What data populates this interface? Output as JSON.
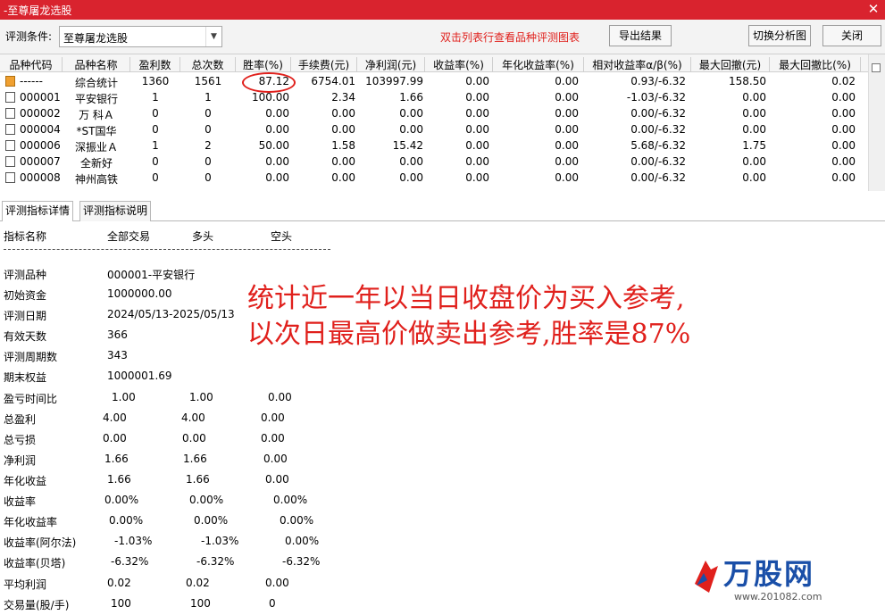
{
  "window": {
    "title": "-至尊屠龙选股"
  },
  "toolbar": {
    "condition_label": "评测条件:",
    "condition_value": "至尊屠龙选股",
    "hint": "双击列表行查看品种评测图表",
    "export_label": "导出结果",
    "switch_label": "切换分析图",
    "close_label": "关闭"
  },
  "grid": {
    "headers": [
      "品种代码",
      "品种名称",
      "盈利数",
      "总次数",
      "胜率(%)",
      "手续费(元)",
      "净利润(元)",
      "收益率(%)",
      "年化收益率(%)",
      "相对收益率α/β(%)",
      "最大回撤(元)",
      "最大回撤比(%)"
    ],
    "rows": [
      [
        "------",
        "综合统计",
        "1360",
        "1561",
        "87.12",
        "6754.01",
        "103997.99",
        "0.00",
        "0.00",
        "0.93/-6.32",
        "158.50",
        "0.02"
      ],
      [
        "000001",
        "平安银行",
        "1",
        "1",
        "100.00",
        "2.34",
        "1.66",
        "0.00",
        "0.00",
        "-1.03/-6.32",
        "0.00",
        "0.00"
      ],
      [
        "000002",
        "万 科Ａ",
        "0",
        "0",
        "0.00",
        "0.00",
        "0.00",
        "0.00",
        "0.00",
        "0.00/-6.32",
        "0.00",
        "0.00"
      ],
      [
        "000004",
        "*ST国华",
        "0",
        "0",
        "0.00",
        "0.00",
        "0.00",
        "0.00",
        "0.00",
        "0.00/-6.32",
        "0.00",
        "0.00"
      ],
      [
        "000006",
        "深振业Ａ",
        "1",
        "2",
        "50.00",
        "1.58",
        "15.42",
        "0.00",
        "0.00",
        "5.68/-6.32",
        "1.75",
        "0.00"
      ],
      [
        "000007",
        "全新好",
        "0",
        "0",
        "0.00",
        "0.00",
        "0.00",
        "0.00",
        "0.00",
        "0.00/-6.32",
        "0.00",
        "0.00"
      ],
      [
        "000008",
        "神州高铁",
        "0",
        "0",
        "0.00",
        "0.00",
        "0.00",
        "0.00",
        "0.00",
        "0.00/-6.32",
        "0.00",
        "0.00"
      ]
    ]
  },
  "tabs": [
    "评测指标详情",
    "评测指标说明"
  ],
  "detail": {
    "columns": [
      "指标名称",
      "全部交易",
      "多头",
      "空头"
    ],
    "single_rows": [
      [
        "评测品种",
        "000001-平安银行"
      ],
      [
        "初始资金",
        "1000000.00"
      ],
      [
        "评测日期",
        "2024/05/13-2025/05/13"
      ],
      [
        "有效天数",
        "366"
      ],
      [
        "评测周期数",
        "343"
      ],
      [
        "期末权益",
        "1000001.69"
      ]
    ],
    "multi_rows": [
      [
        "盈亏时间比",
        "1.00",
        "1.00",
        "0.00"
      ],
      [
        "总盈利",
        "4.00",
        "4.00",
        "0.00"
      ],
      [
        "总亏损",
        "0.00",
        "0.00",
        "0.00"
      ],
      [
        "净利润",
        "1.66",
        "1.66",
        "0.00"
      ],
      [
        "年化收益",
        "1.66",
        "1.66",
        "0.00"
      ],
      [
        "收益率",
        "0.00%",
        "0.00%",
        "0.00%"
      ],
      [
        "年化收益率",
        "0.00%",
        "0.00%",
        "0.00%"
      ],
      [
        "收益率(阿尔法)",
        "-1.03%",
        "-1.03%",
        "0.00%"
      ],
      [
        "收益率(贝塔)",
        "-6.32%",
        "-6.32%",
        "-6.32%"
      ],
      [
        "平均利润",
        "0.02",
        "0.02",
        "0.00"
      ],
      [
        "交易量(股/手)",
        "100",
        "100",
        "0"
      ]
    ]
  },
  "annotation": {
    "line1": "统计近一年以当日收盘价为买入参考,",
    "line2": "以次日最高价做卖出参考,胜率是87%"
  },
  "logo": {
    "brand": "万股网",
    "url": "www.201082.com"
  },
  "colors": {
    "titlebar": "#d9232e",
    "annotation": "#e0201c",
    "brand": "#1a4fa8"
  }
}
